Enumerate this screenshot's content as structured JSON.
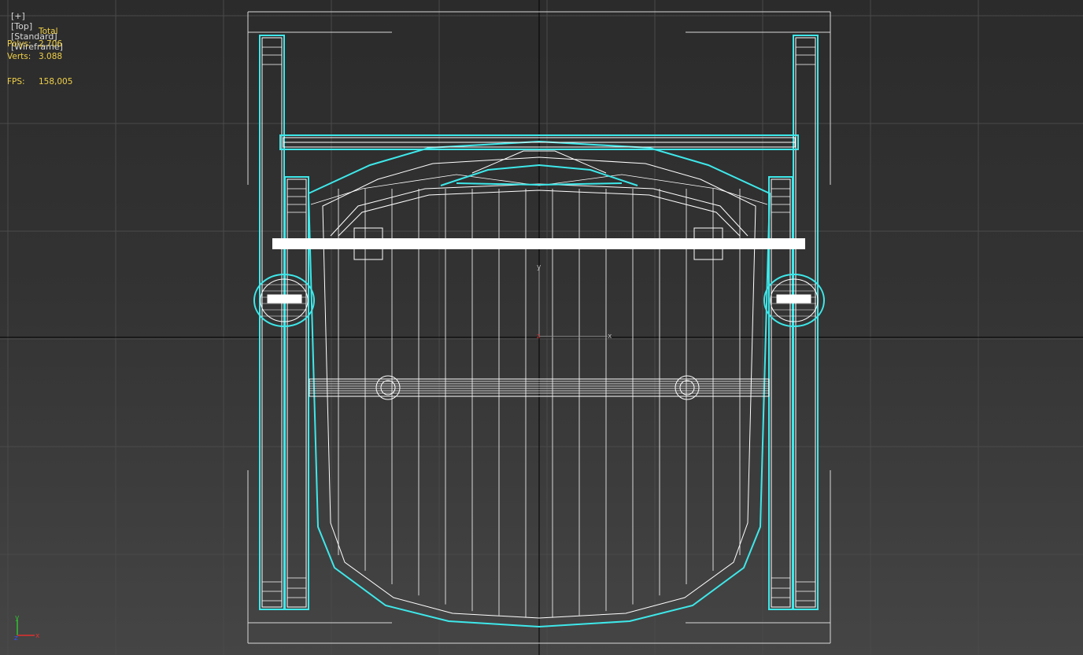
{
  "viewport": {
    "menu_labels": [
      "[+]",
      "[Top]",
      "[Standard]",
      "[Wireframe]"
    ],
    "stats": {
      "header": "Total",
      "polys_label": "Polys:",
      "polys_value": "2.706",
      "verts_label": "Verts:",
      "verts_value": "3.088",
      "fps_label": "FPS:",
      "fps_value": "158,005"
    },
    "gizmo": {
      "y_label": "y",
      "z_label": "z",
      "x_label": "x"
    },
    "colors": {
      "background_top": "#2b2b2b",
      "background_bottom": "#454545",
      "grid": "#4a4a4a",
      "axis": "#000000",
      "wire_white": "#ffffff",
      "wire_selected": "#3ee8ea",
      "stats_text": "#f0d048",
      "axis_x": "#e03030",
      "axis_y": "#30c030",
      "axis_z": "#3050ff"
    },
    "object": "folding chair wireframe (top view)"
  }
}
